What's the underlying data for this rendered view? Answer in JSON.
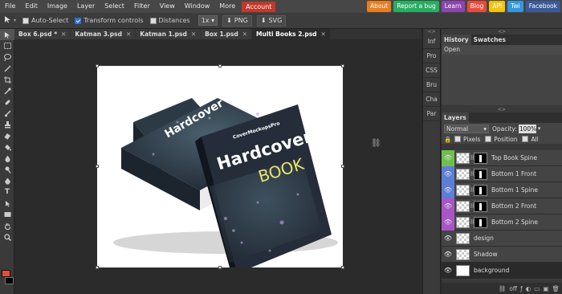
{
  "menu": {
    "items": [
      "File",
      "Edit",
      "Image",
      "Layer",
      "Select",
      "Filter",
      "View",
      "Window",
      "More"
    ],
    "account": "Account",
    "account_color": "#c0392b"
  },
  "top_links": [
    {
      "label": "About",
      "color": "#e67e22"
    },
    {
      "label": "Report a bug",
      "color": "#27ae60"
    },
    {
      "label": "Learn",
      "color": "#8e44ad"
    },
    {
      "label": "Blog",
      "color": "#e74c3c"
    },
    {
      "label": "API",
      "color": "#f1c40f"
    },
    {
      "label": "Twi",
      "color": "#3498db"
    },
    {
      "label": "Facebook",
      "color": "#3b5998"
    }
  ],
  "options": {
    "auto_select": {
      "label": "Auto-Select",
      "checked": false
    },
    "transform_controls": {
      "label": "Transform controls",
      "checked": true
    },
    "distances": {
      "label": "Distances",
      "checked": false
    },
    "zoom": "1x",
    "png_label": "PNG",
    "svg_label": "SVG"
  },
  "tabs": [
    {
      "label": "Box 6.psd *"
    },
    {
      "label": "Katman 3.psd"
    },
    {
      "label": "Katman 1.psd"
    },
    {
      "label": "Box 1.psd"
    },
    {
      "label": "Multi Books 2.psd",
      "active": true
    }
  ],
  "side_tabs": [
    "Inf",
    "Pro",
    "CSS",
    "Bru",
    "Cha",
    "Par"
  ],
  "history_panel": {
    "tabs": [
      "History",
      "Swatches"
    ],
    "rows": [
      "Open"
    ]
  },
  "layers_panel": {
    "title": "Layers",
    "blend_mode": "Normal",
    "opacity_label": "Opacity:",
    "opacity_value": "100%",
    "lock_pixels": "Pixels",
    "lock_position": "Position",
    "lock_all": "All",
    "footer_link": "off",
    "layers": [
      {
        "name": "Top Book Spine",
        "color": "#6fbf4f",
        "mask": true
      },
      {
        "name": "Bottom 1 Front",
        "color": "#5b7fd6",
        "mask": true
      },
      {
        "name": "Bottom 1 Spine",
        "color": "#5b7fd6",
        "mask": true
      },
      {
        "name": "Bottom 2 Front",
        "color": "#a855c8",
        "mask": true
      },
      {
        "name": "Bottom 2 Spine",
        "color": "#a855c8",
        "mask": true
      },
      {
        "name": "design",
        "color": null,
        "mask": false
      },
      {
        "name": "Shadow",
        "color": null,
        "mask": false
      },
      {
        "name": "background",
        "color": null,
        "mask": false,
        "selected": true
      }
    ]
  },
  "canvas": {
    "book_brand": "CoverMockupsPro",
    "book_title_1": "Hardcover",
    "book_title_2": "BOOK",
    "accent_color": "#e8e36a"
  },
  "colors": {
    "foreground": "#e74c3c",
    "background": "#000000"
  }
}
